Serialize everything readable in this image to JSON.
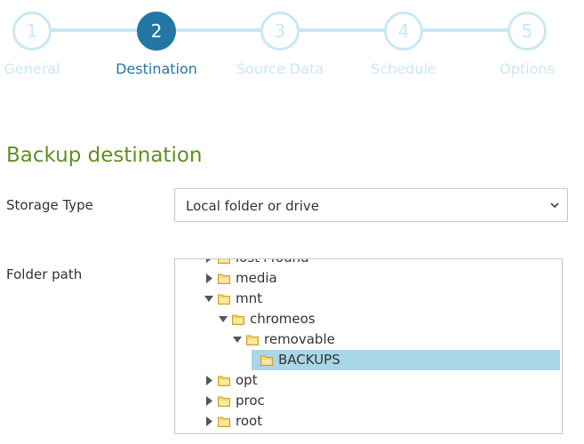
{
  "stepper": {
    "steps": [
      {
        "number": "1",
        "label": "General",
        "state": "inactive"
      },
      {
        "number": "2",
        "label": "Destination",
        "state": "active"
      },
      {
        "number": "3",
        "label": "Source Data",
        "state": "inactive"
      },
      {
        "number": "4",
        "label": "Schedule",
        "state": "inactive"
      },
      {
        "number": "5",
        "label": "Options",
        "state": "inactive"
      }
    ]
  },
  "section": {
    "title": "Backup destination"
  },
  "storage": {
    "label": "Storage Type",
    "value": "Local folder or drive"
  },
  "folder": {
    "label": "Folder path",
    "tree": [
      {
        "label": "lost+found",
        "level": 0,
        "toggle": "collapsed",
        "selected": false
      },
      {
        "label": "media",
        "level": 0,
        "toggle": "collapsed",
        "selected": false
      },
      {
        "label": "mnt",
        "level": 0,
        "toggle": "expanded",
        "selected": false
      },
      {
        "label": "chromeos",
        "level": 1,
        "toggle": "expanded",
        "selected": false
      },
      {
        "label": "removable",
        "level": 2,
        "toggle": "expanded",
        "selected": false
      },
      {
        "label": "BACKUPS",
        "level": 3,
        "toggle": "none",
        "selected": true
      },
      {
        "label": "opt",
        "level": 0,
        "toggle": "collapsed",
        "selected": false
      },
      {
        "label": "proc",
        "level": 0,
        "toggle": "collapsed",
        "selected": false
      },
      {
        "label": "root",
        "level": 0,
        "toggle": "collapsed",
        "selected": false
      }
    ]
  },
  "colors": {
    "accent": "#2477a4",
    "inactive": "#c9e8f4",
    "title_green": "#5f9020",
    "selection": "#a9d6e8",
    "folder_fill": "#f7d774",
    "folder_stroke": "#c9a227"
  },
  "icons": {
    "select_caret": "chevron-down-icon",
    "tree_collapsed": "triangle-right-icon",
    "tree_expanded": "triangle-down-icon",
    "tree_item": "folder-icon"
  }
}
